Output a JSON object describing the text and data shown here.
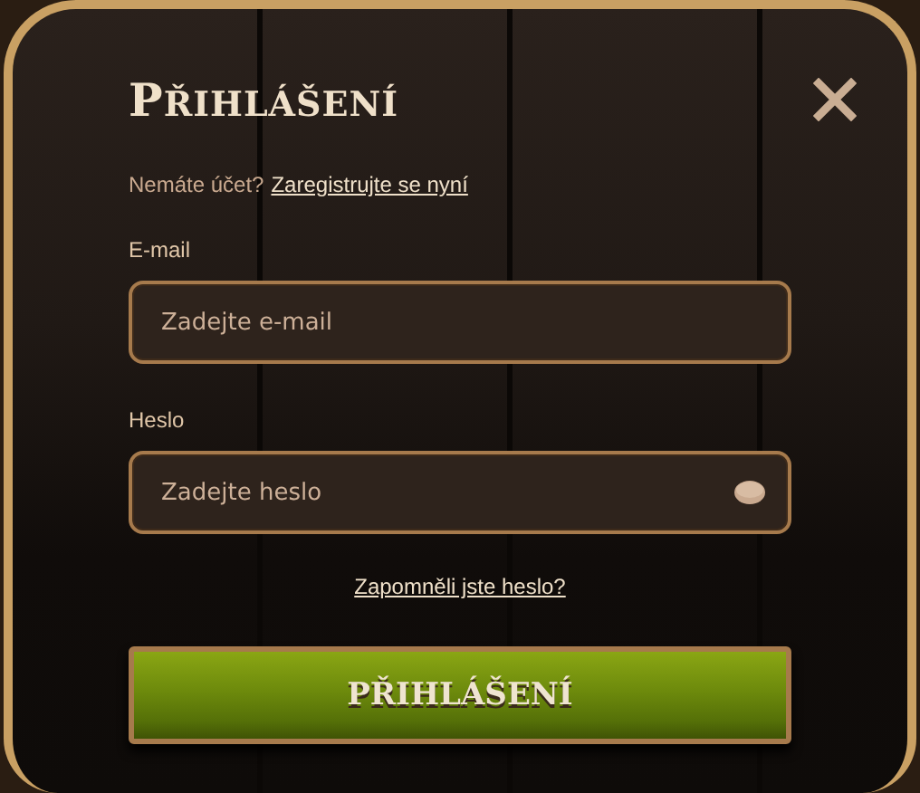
{
  "dialog": {
    "title": "PŘIHLÁŠENÍ"
  },
  "register": {
    "prompt": "Nemáte účet?",
    "link": "Zaregistrujte se nyní"
  },
  "fields": [
    {
      "label": "E-mail",
      "placeholder": "Zadejte e-mail",
      "kind": "text"
    },
    {
      "label": "Heslo",
      "placeholder": "Zadejte heslo",
      "kind": "password"
    }
  ],
  "forgot_link": "Zapomněli jste heslo?",
  "submit": "PŘIHLÁŠENÍ"
}
